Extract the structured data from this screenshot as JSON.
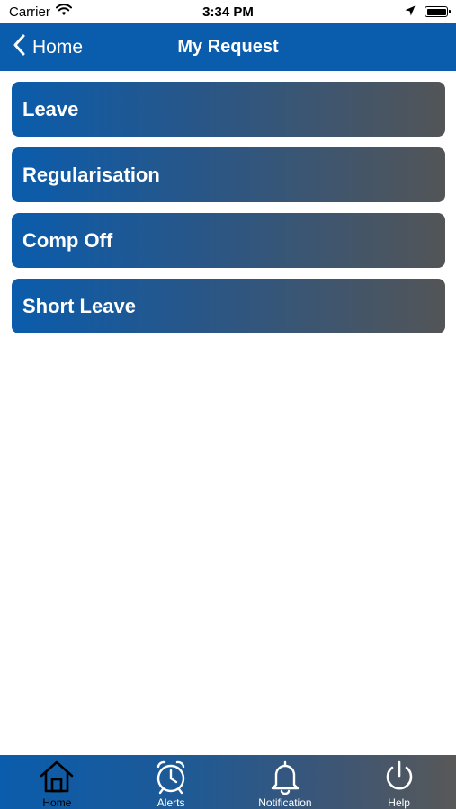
{
  "status_bar": {
    "carrier": "Carrier",
    "time": "3:34 PM",
    "icons": [
      "wifi-icon",
      "location-arrow-icon",
      "battery-icon"
    ]
  },
  "nav": {
    "back_label": "Home",
    "title": "My Request",
    "background_color": "#0a5cac"
  },
  "requests": [
    {
      "label": "Leave"
    },
    {
      "label": "Regularisation"
    },
    {
      "label": "Comp Off"
    },
    {
      "label": "Short Leave"
    }
  ],
  "tab_bar": {
    "items": [
      {
        "label": "Home",
        "icon": "home-icon",
        "active": true
      },
      {
        "label": "Alerts",
        "icon": "alarm-clock-icon",
        "active": false
      },
      {
        "label": "Notification",
        "icon": "bell-icon",
        "active": false
      },
      {
        "label": "Help",
        "icon": "power-icon",
        "active": false
      }
    ]
  },
  "colors": {
    "accent_blue": "#0a5cac",
    "gradient_end_gray": "#535557"
  }
}
